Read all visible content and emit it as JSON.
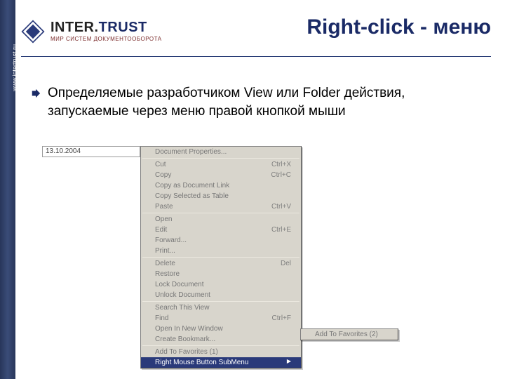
{
  "header": {
    "brand_plain": "INTER.",
    "brand_accent": "TRUST",
    "tagline": "МИР СИСТЕМ ДОКУМЕНТООБОРОТА",
    "sidebar_url": "www.intertrust.ru"
  },
  "title": "Right-click - меню",
  "bullet": "Определяемые разработчиком View или Folder действия, запускаемые через меню правой кнопкой мыши",
  "date_value": "13.10.2004",
  "menu": {
    "groups": [
      [
        {
          "label": "Document Properties...",
          "shortcut": ""
        }
      ],
      [
        {
          "label": "Cut",
          "shortcut": "Ctrl+X"
        },
        {
          "label": "Copy",
          "shortcut": "Ctrl+C"
        },
        {
          "label": "Copy as Document Link",
          "shortcut": ""
        },
        {
          "label": "Copy Selected as Table",
          "shortcut": ""
        },
        {
          "label": "Paste",
          "shortcut": "Ctrl+V"
        }
      ],
      [
        {
          "label": "Open",
          "shortcut": ""
        },
        {
          "label": "Edit",
          "shortcut": "Ctrl+E"
        },
        {
          "label": "Forward...",
          "shortcut": ""
        },
        {
          "label": "Print...",
          "shortcut": ""
        }
      ],
      [
        {
          "label": "Delete",
          "shortcut": "Del"
        },
        {
          "label": "Restore",
          "shortcut": ""
        },
        {
          "label": "Lock Document",
          "shortcut": ""
        },
        {
          "label": "Unlock Document",
          "shortcut": ""
        }
      ],
      [
        {
          "label": "Search This View",
          "shortcut": ""
        },
        {
          "label": "Find",
          "shortcut": "Ctrl+F"
        },
        {
          "label": "Open In New Window",
          "shortcut": ""
        },
        {
          "label": "Create Bookmark...",
          "shortcut": ""
        }
      ],
      [
        {
          "label": "Add To Favorites (1)",
          "shortcut": ""
        },
        {
          "label": "Right Mouse Button SubMenu",
          "shortcut": "",
          "submenu": true,
          "highlight": true
        }
      ]
    ]
  },
  "submenu_item": "Add To Favorites (2)"
}
